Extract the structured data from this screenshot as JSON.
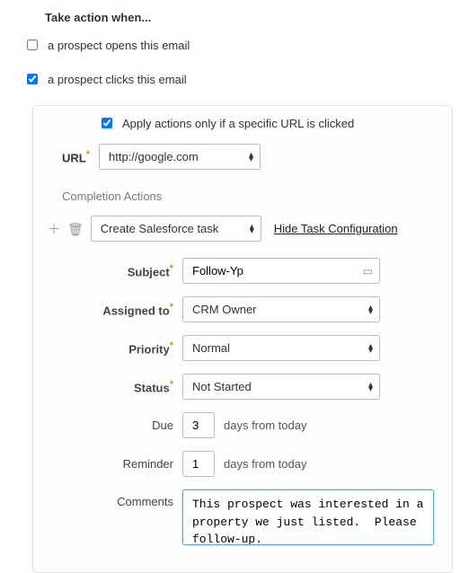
{
  "heading": "Take action when...",
  "triggers": {
    "opens": {
      "label": "a prospect opens this email",
      "checked": false
    },
    "clicks": {
      "label": "a prospect clicks this email",
      "checked": true
    }
  },
  "apply": {
    "label": "Apply actions only if a specific URL is clicked",
    "checked": true
  },
  "url": {
    "label": "URL",
    "value": "http://google.com"
  },
  "completion_section": "Completion Actions",
  "action": {
    "value": "Create Salesforce task",
    "hide_link": "Hide Task Configuration"
  },
  "fields": {
    "subject": {
      "label": "Subject",
      "value": "Follow-Yp"
    },
    "assigned": {
      "label": "Assigned to",
      "value": "CRM Owner"
    },
    "priority": {
      "label": "Priority",
      "value": "Normal"
    },
    "status": {
      "label": "Status",
      "value": "Not Started"
    },
    "due": {
      "label": "Due",
      "value": "3",
      "suffix": "days from today"
    },
    "reminder": {
      "label": "Reminder",
      "value": "1",
      "suffix": "days from today"
    },
    "comments": {
      "label": "Comments",
      "value": "This prospect was interested in a property we just listed.  Please follow-up."
    }
  }
}
